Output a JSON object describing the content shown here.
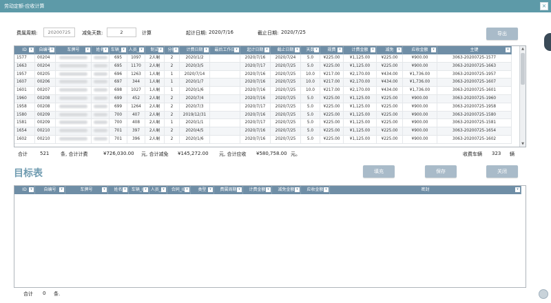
{
  "window": {
    "title": "劳动定额-应收计算",
    "close_glyph": "×"
  },
  "filters": {
    "cycle_label": "费属周期:",
    "cycle_placeholder": "20200725",
    "exempt_days_label": "减免天数:",
    "exempt_days_value": "2",
    "calc_label": "计算",
    "start_date_label": "起计日期:",
    "start_date_value": "2020/7/16",
    "end_date_label": "截止日期:",
    "end_date_value": "2020/7/25"
  },
  "buttons": {
    "export": "导出",
    "fill": "填充",
    "save": "保存",
    "close": "关闭"
  },
  "source_table": {
    "columns": [
      "ID",
      "自编号",
      "车牌号",
      "姓名",
      "车辆_ID",
      "人员_ID",
      "制式",
      "分担",
      "计费日期",
      "最后工作日",
      "起计日期",
      "截止日期",
      "天数",
      "规费",
      "计费金额",
      "减免",
      "应收金额",
      "主键"
    ],
    "rows": [
      [
        "1577",
        "00204",
        "",
        "",
        "695",
        "1097",
        "2人制",
        "2",
        "2020/1/2",
        "",
        "2020/7/16",
        "2020/7/24",
        "5.0",
        "¥225.00",
        "¥1,125.00",
        "¥225.00",
        "¥900.00",
        "3063-20200725-1577"
      ],
      [
        "1663",
        "00204",
        "",
        "",
        "695",
        "1170",
        "2人制",
        "2",
        "2020/3/5",
        "",
        "2020/7/17",
        "2020/7/25",
        "5.0",
        "¥225.00",
        "¥1,125.00",
        "¥225.00",
        "¥900.00",
        "3063-20200725-1663"
      ],
      [
        "1957",
        "00205",
        "",
        "",
        "696",
        "1263",
        "1人制",
        "1",
        "2020/7/14",
        "",
        "2020/7/16",
        "2020/7/25",
        "10.0",
        "¥217.00",
        "¥2,170.00",
        "¥434.00",
        "¥1,736.00",
        "3063-20200725-1957"
      ],
      [
        "1607",
        "00206",
        "",
        "",
        "697",
        "344",
        "1人制",
        "1",
        "2020/1/7",
        "",
        "2020/7/16",
        "2020/7/25",
        "10.0",
        "¥217.00",
        "¥2,170.00",
        "¥434.00",
        "¥1,736.00",
        "3063-20200725-1607"
      ],
      [
        "1601",
        "00207",
        "",
        "",
        "698",
        "1027",
        "1人制",
        "1",
        "2020/1/6",
        "",
        "2020/7/16",
        "2020/7/25",
        "10.0",
        "¥217.00",
        "¥2,170.00",
        "¥434.00",
        "¥1,736.00",
        "3063-20200725-1601"
      ],
      [
        "1960",
        "00208",
        "",
        "",
        "699",
        "452",
        "2人制",
        "2",
        "2020/7/4",
        "",
        "2020/7/16",
        "2020/7/25",
        "5.0",
        "¥225.00",
        "¥1,125.00",
        "¥225.00",
        "¥900.00",
        "3063-20200725-1960"
      ],
      [
        "1958",
        "00208",
        "",
        "",
        "699",
        "1264",
        "2人制",
        "2",
        "2020/7/3",
        "",
        "2020/7/17",
        "2020/7/25",
        "5.0",
        "¥225.00",
        "¥1,125.00",
        "¥225.00",
        "¥900.00",
        "3063-20200725-1958"
      ],
      [
        "1580",
        "00209",
        "",
        "",
        "700",
        "407",
        "2人制",
        "2",
        "2019/12/31",
        "",
        "2020/7/16",
        "2020/7/25",
        "5.0",
        "¥225.00",
        "¥1,125.00",
        "¥225.00",
        "¥900.00",
        "3063-20200725-1580"
      ],
      [
        "1581",
        "00209",
        "",
        "",
        "700",
        "408",
        "2人制",
        "1",
        "2020/1/1",
        "",
        "2020/7/17",
        "2020/7/25",
        "5.0",
        "¥225.00",
        "¥1,125.00",
        "¥225.00",
        "¥900.00",
        "3063-20200725-1581"
      ],
      [
        "1654",
        "00210",
        "",
        "",
        "701",
        "397",
        "2人制",
        "2",
        "2020/4/5",
        "",
        "2020/7/16",
        "2020/7/25",
        "5.0",
        "¥225.00",
        "¥1,125.00",
        "¥225.00",
        "¥900.00",
        "3063-20200725-1654"
      ],
      [
        "1602",
        "00210",
        "",
        "",
        "701",
        "396",
        "2人制",
        "2",
        "2020/1/6",
        "",
        "2020/7/16",
        "2020/7/25",
        "5.0",
        "¥225.00",
        "¥1,125.00",
        "¥225.00",
        "¥900.00",
        "3063-20200725-1602"
      ]
    ]
  },
  "source_summary": {
    "total_label": "合计",
    "count": "521",
    "count_unit": "条, 合计计费",
    "billing_total": "¥726,030.00",
    "reduction_label": "元, 合计减免",
    "reduction_total": "¥145,272.00",
    "receivable_label": "元, 合计应收",
    "receivable_total": "¥580,758.00",
    "yuan_end": "元。",
    "vehicles_label": "收费车辆",
    "vehicles_count": "323",
    "vehicles_unit": "辆"
  },
  "target_section": {
    "title": "目标表"
  },
  "target_table": {
    "columns": [
      "ID",
      "自编号",
      "车牌号",
      "姓名",
      "车辆_ID",
      "人员_ID",
      "合同_ID",
      "类型",
      "费属周期",
      "计费金额",
      "减免金额",
      "应收金额",
      "密封"
    ]
  },
  "target_summary": {
    "total_label": "合计",
    "count": "0",
    "count_unit": "条."
  }
}
